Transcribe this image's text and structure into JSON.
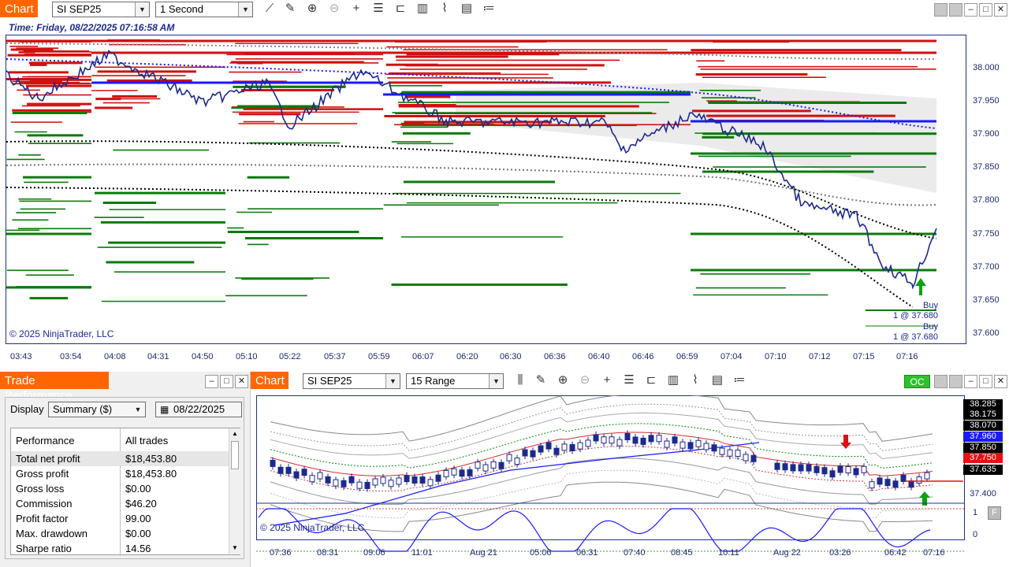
{
  "top_window": {
    "tab_label": "Chart",
    "instrument": "SI SEP25",
    "interval": "1 Second",
    "time_label": "Time: Friday, 08/22/2025 07:16:58 AM",
    "copyright": "© 2025 NinjaTrader, LLC",
    "price_ticks": [
      "38.000",
      "37.950",
      "37.900",
      "37.850",
      "37.800",
      "37.750",
      "37.700",
      "37.650",
      "37.600"
    ],
    "time_ticks": [
      "03:43",
      "03:54",
      "04:08",
      "04:31",
      "04:50",
      "05:10",
      "05:22",
      "05:37",
      "05:59",
      "06:07",
      "06:20",
      "06:30",
      "06:36",
      "06:40",
      "06:46",
      "06:59",
      "07:04",
      "07:10",
      "07:12",
      "07:15",
      "07:16"
    ],
    "trade_labels": [
      {
        "side": "Buy",
        "detail": "1 @ 37.680"
      },
      {
        "side": "Buy",
        "detail": "1 @ 37.680"
      }
    ],
    "toolbar_icons": [
      "line-icon",
      "pencil-icon",
      "zoom-in-icon",
      "zoom-out-icon",
      "crosshair-icon",
      "properties-icon",
      "template-icon",
      "strategies-icon",
      "indicators-icon",
      "data-box-icon",
      "list-icon"
    ]
  },
  "perf_window": {
    "title": "Trade Performance",
    "display_label": "Display",
    "display_value": "Summary ($)",
    "date_value": "08/22/2025",
    "table_headers": [
      "Performance",
      "All trades"
    ],
    "rows": [
      {
        "label": "Total net profit",
        "value": "$18,453.80"
      },
      {
        "label": "Gross profit",
        "value": "$18,453.80"
      },
      {
        "label": "Gross loss",
        "value": "$0.00"
      },
      {
        "label": "Commission",
        "value": "$46.20"
      },
      {
        "label": "Profit factor",
        "value": "99.00"
      },
      {
        "label": "Max. drawdown",
        "value": "$0.00"
      },
      {
        "label": "Sharpe ratio",
        "value": "14.56"
      }
    ]
  },
  "bottom_window": {
    "tab_label": "Chart",
    "instrument": "SI SEP25",
    "interval": "15 Range",
    "oc_label": "OC",
    "copyright": "© 2025 NinjaTrader, LLC",
    "price_ticks": [
      "38.285",
      "38.175",
      "38.070",
      "37.960",
      "37.850",
      "37.750",
      "37.635",
      "37.400"
    ],
    "current_price": "37.750",
    "highlight_price": "37.960",
    "osc_ticks": [
      "1",
      "0"
    ],
    "osc_button": "F",
    "time_ticks": [
      "07:36",
      "08:31",
      "09:06",
      "11:01",
      "Aug 21",
      "05:06",
      "06:31",
      "07:40",
      "08:45",
      "10:11",
      "Aug 22",
      "03:26",
      "06:42",
      "07:16"
    ]
  },
  "colors": {
    "accent_orange": "#ff6600",
    "price_line": "#1c2a8c",
    "bid_green": "#0a7a0a",
    "ask_red": "#d01010",
    "current_price_red": "#e81010",
    "highlight_blue": "#1a1aff"
  }
}
